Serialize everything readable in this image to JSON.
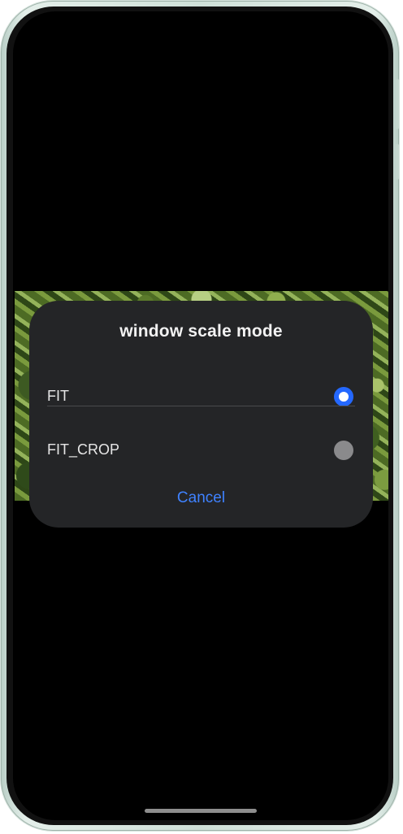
{
  "dialog": {
    "title": "window scale mode",
    "options": [
      {
        "label": "FIT",
        "selected": true
      },
      {
        "label": "FIT_CROP",
        "selected": false
      }
    ],
    "cancel_label": "Cancel"
  },
  "colors": {
    "accent": "#2468FF",
    "cancel_text": "#3F82FF",
    "dialog_bg": "#242527",
    "screen_bg": "#000000"
  },
  "icons": {
    "selected_radio": "radio-checked-icon",
    "unselected_radio": "radio-unchecked-icon"
  }
}
